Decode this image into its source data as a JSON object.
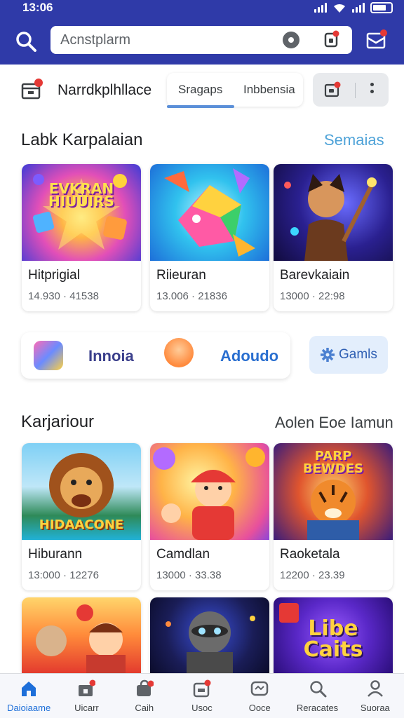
{
  "status": {
    "time": "13:06"
  },
  "search": {
    "placeholder": "Acnstplarm"
  },
  "toolbar": {
    "title": "Narrdkplhllace",
    "tabs": [
      "Sragaps",
      "Inbbensia"
    ]
  },
  "section1": {
    "title": "Labk Karpalaian",
    "link": "Semaias",
    "cards": [
      {
        "name": "Hitprigial",
        "meta": "14.930 · 41538",
        "art_text": "EVKRAN\nHIUUIRS"
      },
      {
        "name": "Riieuran",
        "meta": "13.006 · 21836"
      },
      {
        "name": "Barevkaiain",
        "meta": "13000 · 22:98"
      }
    ]
  },
  "categories": {
    "items": [
      {
        "label": "Innoia",
        "color": "#3b3f8c"
      },
      {
        "label": "Adoudo",
        "color": "#2a6fd0"
      }
    ],
    "games_button": "Gamls"
  },
  "section2": {
    "title": "Karjariour",
    "link": "Aolen Eoe Iamun",
    "cards": [
      {
        "name": "Hiburann",
        "meta": "13:000 · 12276",
        "art_text": "HIDAACONE"
      },
      {
        "name": "Camdlan",
        "meta": "13000 · 33.38"
      },
      {
        "name": "Raoketala",
        "meta": "12200 · 23.39",
        "art_text": "PARP\nBEWDES"
      }
    ]
  },
  "section3": {
    "cards": [
      {
        "art_text": ""
      },
      {
        "art_text": ""
      },
      {
        "art_text": "Libe\nCaits"
      }
    ]
  },
  "bottom_nav": [
    {
      "label": "Daioiaame",
      "icon": "home-icon",
      "active": true
    },
    {
      "label": "Uicarr",
      "icon": "store-icon"
    },
    {
      "label": "Caih",
      "icon": "bag-icon"
    },
    {
      "label": "Usoc",
      "icon": "inbox-icon"
    },
    {
      "label": "Ooce",
      "icon": "chat-icon"
    },
    {
      "label": "Reracates",
      "icon": "search-icon"
    },
    {
      "label": "Suoraa",
      "icon": "profile-icon"
    }
  ],
  "colors": {
    "header": "#2f3aa8",
    "accent": "#1e6fd9",
    "link": "#4fa3d8",
    "badge": "#e53935"
  }
}
